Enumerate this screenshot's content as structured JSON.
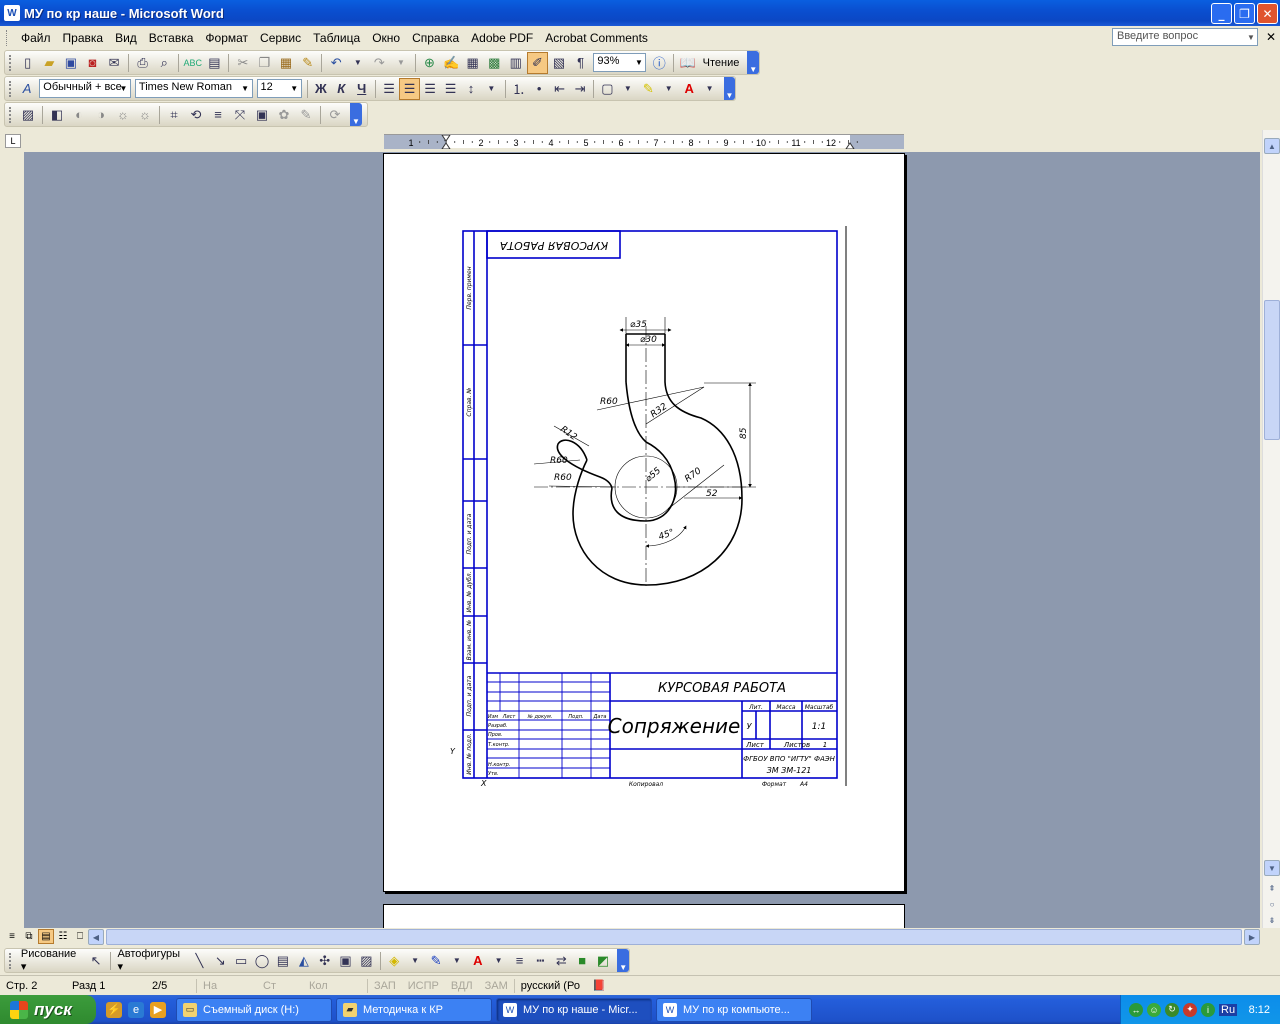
{
  "window": {
    "title": "МУ по кр наше - Microsoft Word",
    "app_icon": "W"
  },
  "menu": [
    "Файл",
    "Правка",
    "Вид",
    "Вставка",
    "Формат",
    "Сервис",
    "Таблица",
    "Окно",
    "Справка",
    "Adobe PDF",
    "Acrobat Comments"
  ],
  "ask": {
    "placeholder": "Введите вопрос"
  },
  "toolbar_standard": {
    "zoom": "93%",
    "read_label": "Чтение"
  },
  "toolbar_format": {
    "style": "Обычный + все",
    "font": "Times New Roman",
    "size": "12",
    "bold": "Ж",
    "italic": "К",
    "underline": "Ч"
  },
  "ruler": {
    "numbers": [
      "1",
      "1",
      "2",
      "3",
      "4",
      "5",
      "6",
      "7",
      "8",
      "9",
      "10",
      "11",
      "12"
    ]
  },
  "drawing": {
    "frame_title_top": "КУРСОВАЯ РАБОТА",
    "side_labels": [
      "Перв. примен",
      "Справ. №",
      "Подп. и дата",
      "Инв. № дубл.",
      "Взам. инв. №",
      "Подп. и дата",
      "Инв. № подл."
    ],
    "dims": {
      "d35": "⌀35",
      "d30": "⌀30",
      "r60a": "R60",
      "r32": "R32",
      "r12": "R12",
      "r60b": "R60",
      "r60c": "R60",
      "d55": "⌀55",
      "r70": "R70",
      "v85": "85",
      "v52": "52",
      "a45": "45°"
    },
    "titleblock": {
      "title": "КУРСОВАЯ РАБОТА",
      "name": "Сопряжение",
      "lit_label": "Лит.",
      "mass_label": "Масса",
      "scale_label": "Масштаб",
      "lit_value": "У",
      "scale_value": "1:1",
      "sheet_label": "Лист",
      "sheets_label": "Листов",
      "sheets_value": "1",
      "org": "ФГБОУ ВПО \"ИГТУ\" ФАЭН",
      "group": "ЗМ    ЗМ-121",
      "cols": [
        "Изм",
        "Лист",
        "№ докум.",
        "Подп.",
        "Дата"
      ],
      "rows": [
        "Разраб.",
        "Пров.",
        "Т.контр.",
        "",
        "Н.контр.",
        "Утв."
      ],
      "copied": "Копировал",
      "format": "Формат",
      "format_value": "А4"
    },
    "axis_y": "Y",
    "axis_x": "X"
  },
  "drawbar": {
    "draw_label": "Рисование ▾",
    "autoshapes_label": "Автофигуры ▾"
  },
  "status": {
    "page": "Стр. 2",
    "section": "Разд 1",
    "pages": "2/5",
    "at": "На",
    "ln": "Ст",
    "col": "Кол",
    "rec": "ЗАП",
    "trk": "ИСПР",
    "ext": "ВДЛ",
    "ovr": "ЗАМ",
    "lang": "русский (Ро"
  },
  "taskbar": {
    "start": "пуск",
    "tasks": [
      "Съемный диск (H:)",
      "Методичка к КР",
      "МУ по кр наше - Micr...",
      "МУ по кр компьюте..."
    ],
    "lang": "Ru",
    "clock": "8:12"
  },
  "colors": {
    "frame": "#0000cc",
    "doc_bg": "#8d99ae",
    "titlebar": "#0b4fd0"
  }
}
